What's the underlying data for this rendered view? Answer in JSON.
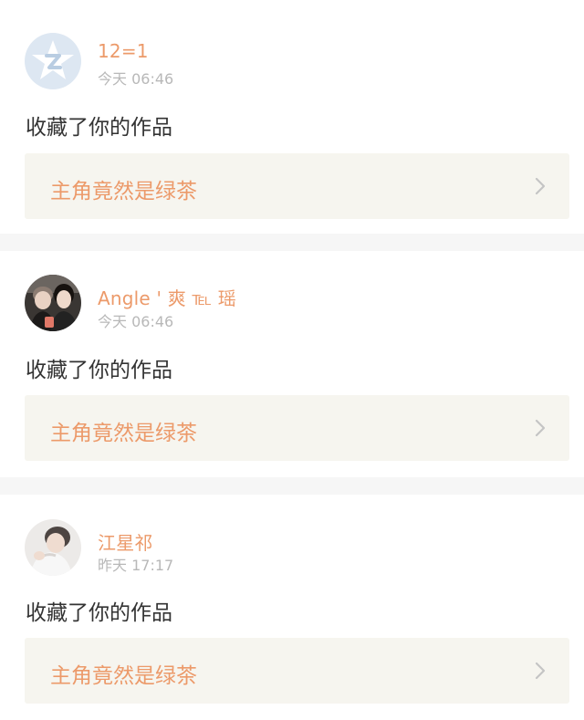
{
  "notifications": [
    {
      "user_name": "12=1",
      "time": "今天 06:46",
      "action": "收藏了你的作品",
      "work_title": "主角竟然是绿茶",
      "avatar": "qq-default-avatar"
    },
    {
      "user_name": "Angle ' 爽 ℡ 瑶",
      "time": "今天 06:46",
      "action": "收藏了你的作品",
      "work_title": "主角竟然是绿茶",
      "avatar": "user-photo-avatar"
    },
    {
      "user_name": "江星祁",
      "time": "昨天 17:17",
      "action": "收藏了你的作品",
      "work_title": "主角竟然是绿茶",
      "avatar": "user-photo-avatar"
    }
  ],
  "colors": {
    "accent": "#ec9a6a",
    "tab_indicator": "#e86fb0",
    "box_background": "#f6f5ef",
    "separator": "#f6f6f6",
    "time_text": "#b8b8b8"
  },
  "icons": {
    "chevron": "chevron-right-icon"
  }
}
